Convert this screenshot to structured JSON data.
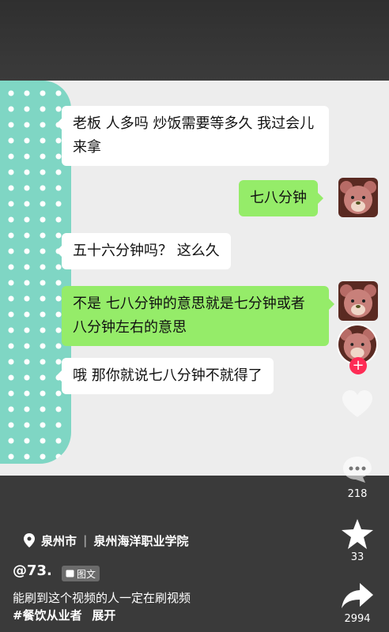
{
  "chat": {
    "messages": [
      {
        "side": "left",
        "text": "老板 人多吗 炒饭需要等多久 我过会儿来拿"
      },
      {
        "side": "right",
        "text": "七八分钟"
      },
      {
        "side": "left",
        "text": "五十六分钟吗？ 这么久"
      },
      {
        "side": "right",
        "text": "不是 七八分钟的意思就是七分钟或者八分钟左右的意思"
      },
      {
        "side": "left",
        "text": "哦 那你就说七八分钟不就得了"
      }
    ],
    "input_placeholder": ""
  },
  "rail": {
    "avatar_icon": "bear-avatar-icon",
    "follow_icon": "plus-icon",
    "like_icon": "heart-icon",
    "comment_icon": "comment-icon",
    "comment_count": "218",
    "favorite_icon": "star-icon",
    "favorite_count": "33",
    "share_icon": "share-icon",
    "share_count": "2994"
  },
  "post": {
    "location_city": "泉州市",
    "location_place": "泉州海洋职业学院",
    "author": "@73.",
    "tag_label": "图文",
    "description": "能刷到这个视频的人一定在刷视频",
    "hashtag": "#餐饮从业者",
    "expand_label": "展开"
  },
  "colors": {
    "dots": "#7fd6c4",
    "bubble_green": "#95ec69",
    "follow": "#fe2c55"
  }
}
